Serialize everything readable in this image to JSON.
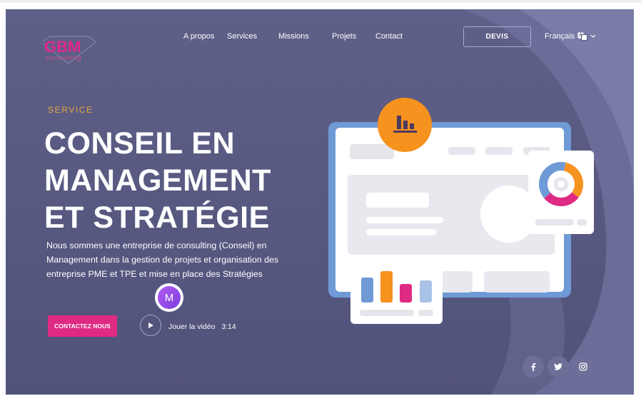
{
  "brand": {
    "logo_text": "GBM",
    "logo_subtitle": "consulting"
  },
  "nav": {
    "items": [
      {
        "label": "A propos"
      },
      {
        "label": "Services"
      },
      {
        "label": "Missions"
      },
      {
        "label": "Projets"
      },
      {
        "label": "Contact"
      }
    ],
    "devis_label": "DEVIS",
    "language": "Français"
  },
  "hero": {
    "eyebrow": "SERVICE",
    "title_lines": [
      "CONSEIL EN",
      "MANAGEMENT",
      "ET STRATÉGIE"
    ],
    "description": "Nous sommes une entreprise de consulting (Conseil) en Management dans la gestion de projets et organisation des entreprise PME et TPE et mise en place des Stratégies",
    "cta_label": "CONTACTEZ NOUS",
    "video_label": "Jouer la vidéo",
    "video_duration": "3:14"
  },
  "avatar_letter": "M",
  "social": [
    {
      "icon": "facebook-icon"
    },
    {
      "icon": "twitter-icon"
    },
    {
      "icon": "instagram-icon"
    }
  ],
  "colors": {
    "background": "#5a5c84",
    "accent_pink": "#df2a84",
    "accent_orange": "#f6921e",
    "eyebrow": "#e7a73e",
    "frame_blue": "#6f9ad6"
  }
}
